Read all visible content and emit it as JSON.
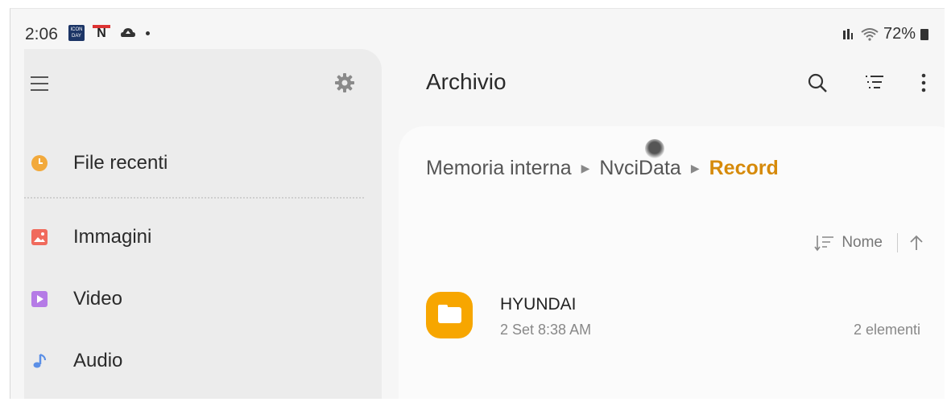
{
  "status_bar": {
    "time": "2:06",
    "right_text": "72%",
    "news_badge": "ICON DAY",
    "notification_n": "N",
    "icons": [
      "news-app-icon",
      "n-app-icon",
      "cloud-icon",
      "dot-icon",
      "signal-icon",
      "wifi-icon",
      "battery-icon"
    ]
  },
  "drawer": {
    "items": [
      {
        "label": "File recenti",
        "icon": "clock-icon",
        "color": "#f2a93b"
      },
      {
        "label": "Immagini",
        "icon": "image-icon",
        "color": "#f06a5c"
      },
      {
        "label": "Video",
        "icon": "play-icon",
        "color": "#b57be6"
      },
      {
        "label": "Audio",
        "icon": "music-note-icon",
        "color": "#5b8fe6"
      }
    ]
  },
  "header": {
    "title": "Archivio",
    "actions": [
      "search-icon",
      "filter-list-icon",
      "more-vert-icon"
    ]
  },
  "breadcrumb": {
    "items": [
      "Memoria interna",
      "NvciData"
    ],
    "current": "Record",
    "current_color": "#d68a0a"
  },
  "sort": {
    "label": "Nome"
  },
  "files": [
    {
      "name": "HYUNDAI",
      "date": "2 Set 8:38 AM",
      "count": "2 elementi",
      "icon_color": "#f7a600"
    }
  ]
}
